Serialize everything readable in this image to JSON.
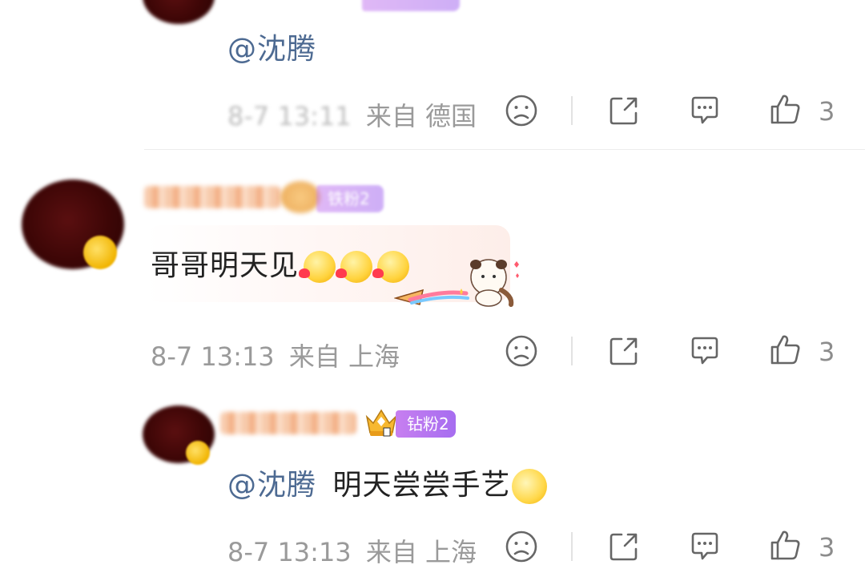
{
  "comment1": {
    "content_mention": "@沈腾",
    "timestamp": "8-7 13:11",
    "location": "来自 德国",
    "like_count": "3"
  },
  "comment2": {
    "content_text": "哥哥明天见",
    "badge_label": "铁粉2",
    "timestamp": "8-7 13:13",
    "location": "来自 上海",
    "like_count": "3"
  },
  "reply1": {
    "badge_label": "钻粉2",
    "mention": "@沈腾",
    "content_text": "明天尝尝手艺",
    "timestamp": "8-7 13:13",
    "location": "来自 上海",
    "like_count": "3"
  },
  "colors": {
    "mention": "#4d6a92",
    "meta": "#9a9a9a",
    "badge": "#b576f0"
  },
  "icons": [
    "dislike-face-icon",
    "share-icon",
    "comment-icon",
    "thumbs-up-icon",
    "crown-icon",
    "kiss-emoji-icon",
    "panda-sticker-icon"
  ]
}
